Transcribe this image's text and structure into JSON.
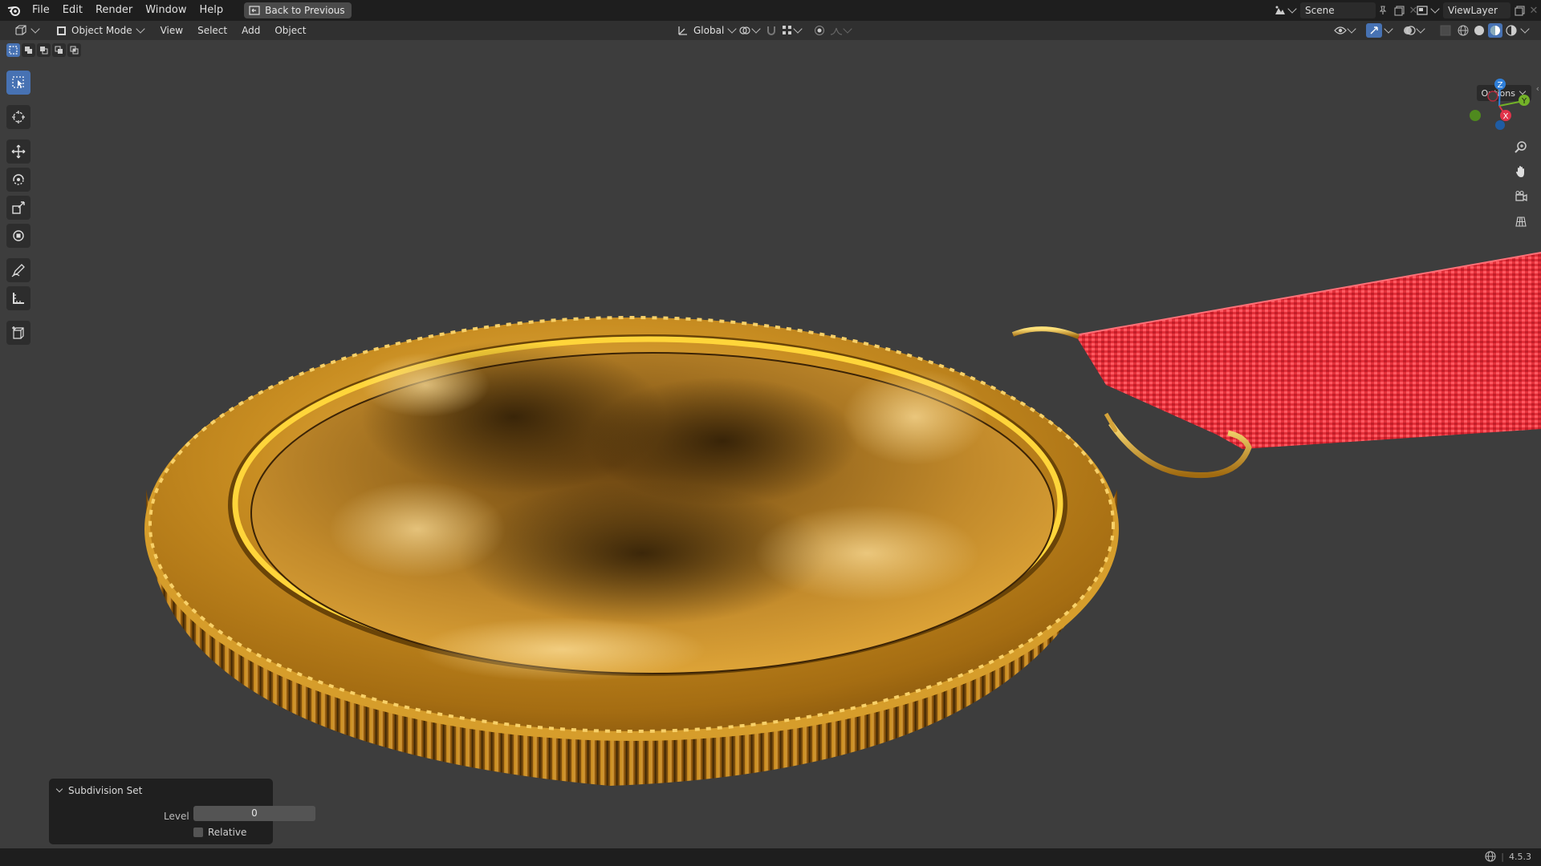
{
  "topbar": {
    "menus": [
      "File",
      "Edit",
      "Render",
      "Window",
      "Help"
    ],
    "back_label": "Back to Previous",
    "scene": "Scene",
    "view_layer": "ViewLayer"
  },
  "header": {
    "mode": "Object Mode",
    "menus": [
      "View",
      "Select",
      "Add",
      "Object"
    ],
    "orientation": "Global",
    "options_label": "Options"
  },
  "gizmo": {
    "z": "Z",
    "y": "Y",
    "x": "X"
  },
  "panel": {
    "title": "Subdivision Set",
    "level_label": "Level",
    "level_value": "0",
    "relative_label": "Relative",
    "relative_checked": false
  },
  "status": {
    "version": "4.5.3"
  },
  "colors": {
    "accent": "#4772b3",
    "ribbon": "#e0303a",
    "gold": "#c8901a"
  }
}
